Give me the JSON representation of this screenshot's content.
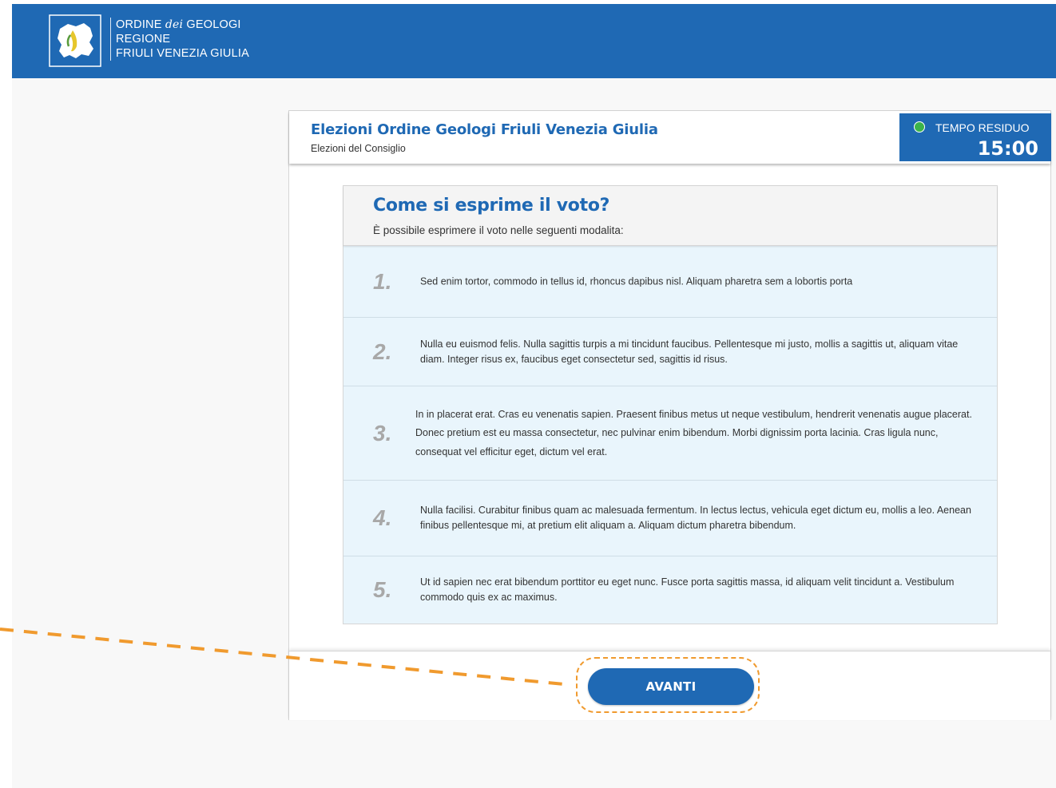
{
  "header": {
    "org_line1_a": "ORDINE ",
    "org_line1_dei": "dei",
    "org_line1_b": " GEOLOGI",
    "org_line2": "REGIONE",
    "org_line3": "FRIULI VENEZIA GIULIA",
    "logo_icon": "region-map-logo-icon"
  },
  "election": {
    "title": "Elezioni Ordine Geologi Friuli Venezia Giulia",
    "subtitle": "Elezioni del Consiglio"
  },
  "timer": {
    "label": "TEMPO RESIDUO",
    "value": "15:00",
    "status_color": "#3cb44a"
  },
  "instructions": {
    "title": "Come si esprime il voto?",
    "subtitle": "È possibile esprimere il voto nelle seguenti modalita:",
    "steps": [
      {
        "num": "1.",
        "text": "Sed enim tortor, commodo in tellus id, rhoncus dapibus nisl. Aliquam pharetra sem a lobortis porta"
      },
      {
        "num": "2.",
        "text": "Nulla eu euismod felis. Nulla sagittis turpis a mi tincidunt faucibus. Pellentesque mi justo, mollis a sagittis ut, aliquam vitae diam. Integer risus ex, faucibus eget consectetur sed, sagittis id risus."
      },
      {
        "num": "3.",
        "text": "In in placerat erat. Cras eu venenatis sapien. Praesent finibus metus ut neque vestibulum, hendrerit venenatis augue placerat. Donec pretium est eu massa consectetur, nec pulvinar enim bibendum. Morbi dignissim porta lacinia. Cras ligula nunc, consequat vel efficitur eget, dictum vel erat."
      },
      {
        "num": "4.",
        "text": "Nulla facilisi. Curabitur finibus quam ac malesuada fermentum. In lectus lectus, vehicula eget dictum eu, mollis a leo. Aenean finibus pellentesque mi, at pretium elit aliquam a. Aliquam dictum pharetra bibendum."
      },
      {
        "num": "5.",
        "text": "Ut id sapien nec erat bibendum porttitor eu eget nunc. Fusce porta sagittis massa, id aliquam velit tincidunt a. Vestibulum commodo quis ex ac maximus."
      }
    ]
  },
  "footer": {
    "next_label": "AVANTI"
  },
  "colors": {
    "brand_blue": "#1f69b4",
    "step_bg": "#e9f5fc",
    "callout_orange": "#f09a2e"
  }
}
